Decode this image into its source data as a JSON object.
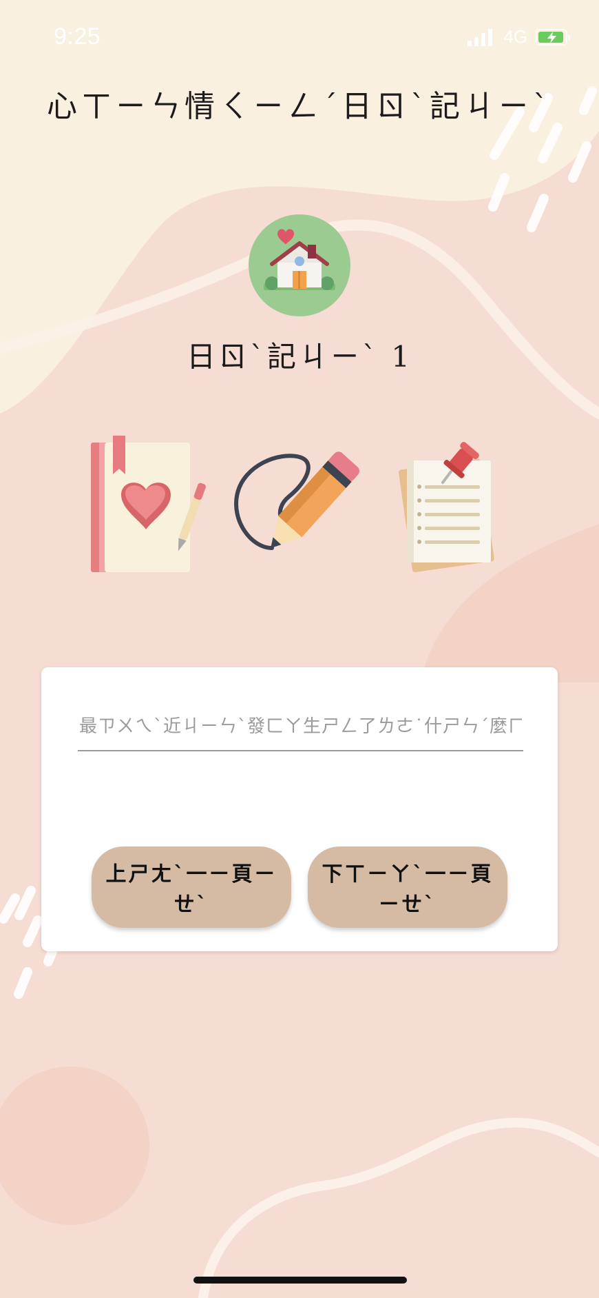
{
  "status_bar": {
    "time": "9:25",
    "network": "4G",
    "icons": [
      "signal-icon",
      "battery-charging-icon"
    ]
  },
  "header": {
    "title": "心ㄒㄧㄣ情ㄑㄧㄥˊ日ㄖˋ記ㄐㄧˋ"
  },
  "diary": {
    "avatar_icon": "house-with-heart-icon",
    "name": "日ㄖˋ記ㄐㄧˋ 1"
  },
  "illustrations": [
    "heart-book-icon",
    "pencil-scribble-icon",
    "pinned-notes-icon"
  ],
  "entry": {
    "value": "",
    "placeholder": "最ㄗㄨㄟˋ近ㄐㄧㄣˋ發ㄈㄚ生ㄕㄥ了ㄌㄜ˙什ㄕㄣˊ麼ㄇㄜ˙事ㄕˋ情ㄑㄧㄥˊ....."
  },
  "buttons": {
    "prev_label": "上ㄕㄤˋ一ㄧ頁ㄧㄝˋ",
    "next_label": "下ㄒㄧㄚˋ一ㄧ頁ㄧㄝˋ"
  },
  "colors": {
    "background": "#F6DDD3",
    "top_blob": "#FAF0DF",
    "button": "#D5BBA4",
    "avatar_bg": "#9CCB92"
  }
}
